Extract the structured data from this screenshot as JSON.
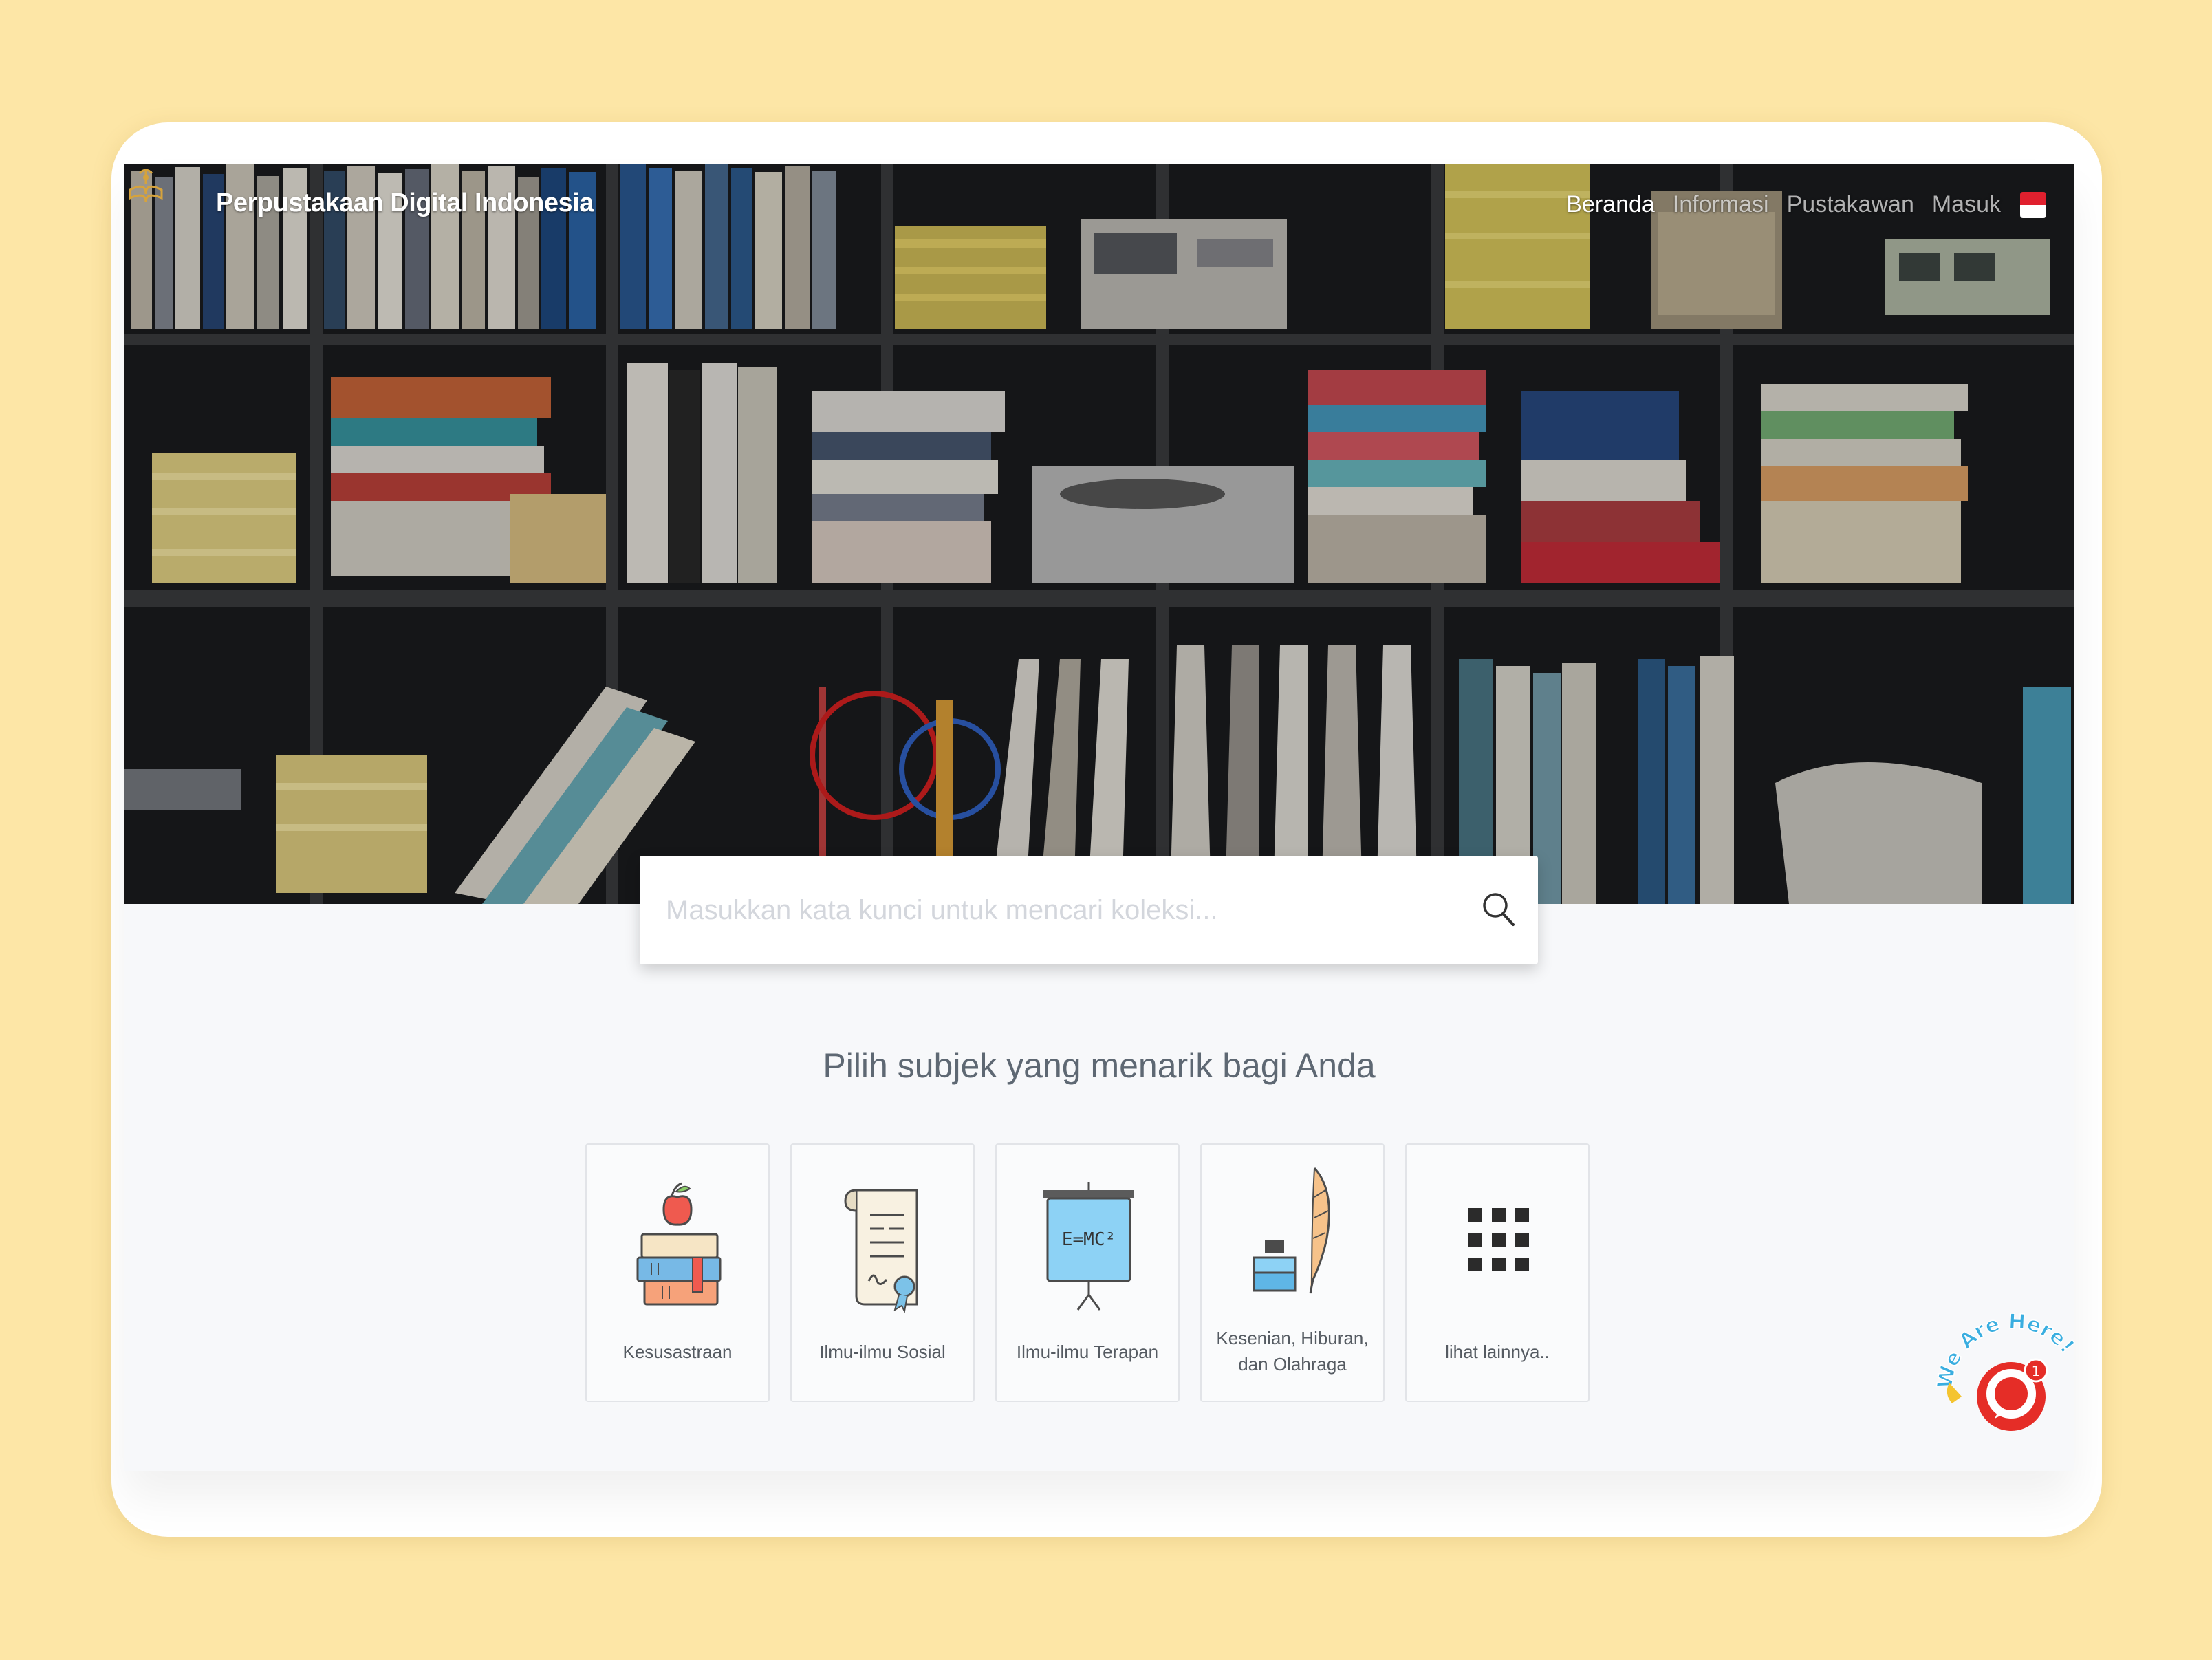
{
  "brand": {
    "name": "Perpustakaan Digital Indonesia",
    "logo_icon": "book-lamp-logo-icon"
  },
  "nav": {
    "items": [
      {
        "label": "Beranda",
        "active": true
      },
      {
        "label": "Informasi",
        "active": false
      },
      {
        "label": "Pustakawan",
        "active": false
      },
      {
        "label": "Masuk",
        "active": false
      }
    ],
    "language_flag": "indonesia-flag-icon"
  },
  "search": {
    "placeholder": "Masukkan kata kunci untuk mencari koleksi...",
    "icon": "search-icon"
  },
  "subjects": {
    "title": "Pilih subjek yang menarik bagi Anda",
    "items": [
      {
        "label": "Kesusastraan",
        "icon": "books-apple-icon"
      },
      {
        "label": "Ilmu-ilmu Sosial",
        "icon": "certificate-scroll-icon"
      },
      {
        "label": "Ilmu-ilmu Terapan",
        "icon": "whiteboard-formula-icon"
      },
      {
        "label": "Kesenian, Hiburan, dan Olahraga",
        "icon": "ink-quill-icon"
      },
      {
        "label": "lihat lainnya..",
        "icon": "grid-dots-icon"
      }
    ]
  },
  "chat_widget": {
    "banner": "We Are Here!",
    "badge_count": "1"
  },
  "colors": {
    "page_bg": "#fde6a6",
    "screen_bg": "#f7f8fa",
    "accent_red": "#e52d27",
    "text_muted": "#5e6873"
  }
}
